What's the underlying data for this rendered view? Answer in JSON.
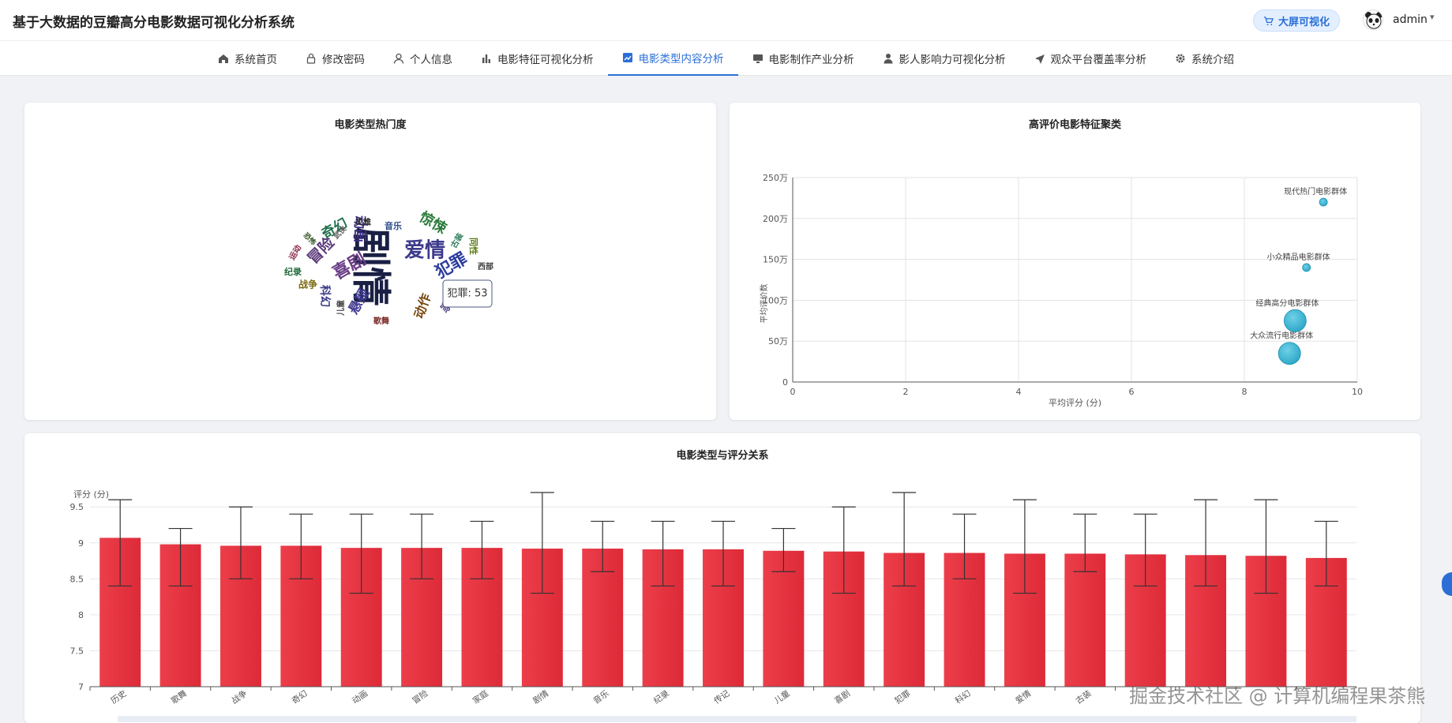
{
  "header": {
    "title": "基于大数据的豆瓣高分电影数据可视化分析系统",
    "bigscreen_label": "大屏可视化",
    "user": "admin"
  },
  "nav": [
    {
      "label": "系统首页",
      "icon": "home-icon"
    },
    {
      "label": "修改密码",
      "icon": "lock-icon"
    },
    {
      "label": "个人信息",
      "icon": "user-icon"
    },
    {
      "label": "电影特征可视化分析",
      "icon": "bar-chart-icon"
    },
    {
      "label": "电影类型内容分析",
      "icon": "area-chart-icon",
      "active": true
    },
    {
      "label": "电影制作产业分析",
      "icon": "monitor-icon"
    },
    {
      "label": "影人影响力可视化分析",
      "icon": "person-icon"
    },
    {
      "label": "观众平台覆盖率分析",
      "icon": "send-icon"
    },
    {
      "label": "系统介绍",
      "icon": "gear-icon"
    }
  ],
  "colors": {
    "accent": "#2b6fd6",
    "bubble": "#2aa6c6",
    "bar": "#e23a45"
  },
  "wordcloud": {
    "title": "电影类型热门度",
    "tooltip": "犯罪: 53",
    "words": [
      {
        "text": "剧情",
        "color": "#1a2044"
      },
      {
        "text": "爱情",
        "color": "#3d3a8c"
      },
      {
        "text": "犯罪",
        "color": "#2b3c9e"
      },
      {
        "text": "喜剧",
        "color": "#6a3d86"
      },
      {
        "text": "动画",
        "color": "#3c2f82"
      },
      {
        "text": "惊悚",
        "color": "#2b7a3a"
      },
      {
        "text": "冒险",
        "color": "#5b3a7a"
      },
      {
        "text": "奇幻",
        "color": "#1f6f4d"
      },
      {
        "text": "悬疑",
        "color": "#3f3a90"
      },
      {
        "text": "动作",
        "color": "#7a4a12"
      },
      {
        "text": "家庭",
        "color": "#5a4a8a"
      },
      {
        "text": "科幻",
        "color": "#3b3b8a"
      },
      {
        "text": "战争",
        "color": "#7a6a12"
      },
      {
        "text": "纪录",
        "color": "#1f6a3a"
      },
      {
        "text": "音乐",
        "color": "#2b4c8a"
      },
      {
        "text": "灾难",
        "color": "#222222"
      },
      {
        "text": "古装",
        "color": "#2b7a5a"
      },
      {
        "text": "同性",
        "color": "#5a7a12"
      },
      {
        "text": "西部",
        "color": "#3a3a3a"
      },
      {
        "text": "儿童",
        "color": "#444444"
      },
      {
        "text": "歌舞",
        "color": "#7a2a2a"
      },
      {
        "text": "运动",
        "color": "#8a2a4a"
      },
      {
        "text": "武侠",
        "color": "#5a5a5a"
      },
      {
        "text": "恐怖",
        "color": "#3a5a2a"
      }
    ]
  },
  "chart_data": [
    {
      "type": "scatter",
      "title": "高评价电影特征聚类",
      "xlabel": "平均评分 (分)",
      "ylabel": "平均评价数",
      "xlim": [
        0,
        10
      ],
      "ylim": [
        0,
        2500000
      ],
      "xticks": [
        "0",
        "2",
        "4",
        "6",
        "8",
        "10"
      ],
      "yticks": [
        "0",
        "50万",
        "100万",
        "150万",
        "200万",
        "250万"
      ],
      "grid": true,
      "points": [
        {
          "label": "现代热门电影群体",
          "x": 9.4,
          "y": 2200000,
          "size": "small"
        },
        {
          "label": "小众精品电影群体",
          "x": 9.1,
          "y": 1400000,
          "size": "small"
        },
        {
          "label": "经典高分电影群体",
          "x": 8.9,
          "y": 750000,
          "size": "large"
        },
        {
          "label": "大众流行电影群体",
          "x": 8.8,
          "y": 350000,
          "size": "large"
        }
      ]
    },
    {
      "type": "bar",
      "title": "电影类型与评分关系",
      "ylabel": "评分 (分)",
      "ylim": [
        7,
        9.7
      ],
      "yticks": [
        "7",
        "7.5",
        "8",
        "8.5",
        "9",
        "9.5"
      ],
      "grid": true,
      "categories": [
        "历史",
        "歌舞",
        "战争",
        "奇幻",
        "动画",
        "冒险",
        "家庭",
        "剧情",
        "音乐",
        "纪录",
        "传记",
        "儿童",
        "喜剧",
        "犯罪",
        "科幻",
        "爱情",
        "古装",
        "",
        "",
        "",
        ""
      ],
      "values": [
        9.07,
        8.98,
        8.96,
        8.96,
        8.93,
        8.93,
        8.93,
        8.92,
        8.92,
        8.91,
        8.91,
        8.89,
        8.88,
        8.86,
        8.86,
        8.85,
        8.85,
        8.84,
        8.83,
        8.82,
        8.79
      ],
      "error_low": [
        8.4,
        8.4,
        8.5,
        8.5,
        8.3,
        8.5,
        8.5,
        8.3,
        8.6,
        8.4,
        8.4,
        8.6,
        8.3,
        8.4,
        8.5,
        8.3,
        8.6,
        8.4,
        8.4,
        8.3,
        8.4
      ],
      "error_high": [
        9.6,
        9.2,
        9.5,
        9.4,
        9.4,
        9.4,
        9.3,
        9.7,
        9.3,
        9.3,
        9.3,
        9.2,
        9.5,
        9.7,
        9.4,
        9.6,
        9.4,
        9.4,
        9.6,
        9.6,
        9.3
      ]
    }
  ],
  "watermark": "掘金技术社区 @ 计算机编程果茶熊"
}
